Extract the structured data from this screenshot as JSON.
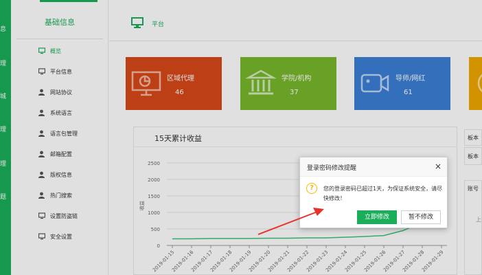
{
  "strip_chars": [
    "息",
    "理",
    "城",
    "理",
    "理",
    "题"
  ],
  "sidebar": {
    "title": "基础信息",
    "items": [
      {
        "label": "概览",
        "icon": "monitor-icon"
      },
      {
        "label": "平台信息",
        "icon": "monitor-icon"
      },
      {
        "label": "网站协议",
        "icon": "user-icon"
      },
      {
        "label": "系统语言",
        "icon": "user-icon"
      },
      {
        "label": "语言包管理",
        "icon": "user-icon"
      },
      {
        "label": "邮箱配置",
        "icon": "user-icon"
      },
      {
        "label": "版权信息",
        "icon": "user-icon"
      },
      {
        "label": "热门搜索",
        "icon": "user-icon"
      },
      {
        "label": "设置防盗链",
        "icon": "monitor-icon"
      },
      {
        "label": "安全设置",
        "icon": "monitor-icon"
      }
    ]
  },
  "header": {
    "title": "平台",
    "icon": "monitor-icon"
  },
  "cards": [
    {
      "label": "区域代理",
      "value": "46",
      "color": "#d6481a",
      "icon": "presentation-chart-icon"
    },
    {
      "label": "学院/机构",
      "value": "37",
      "color": "#77b82c",
      "icon": "institution-icon"
    },
    {
      "label": "导师/网红",
      "value": "61",
      "color": "#3c7fd6",
      "icon": "video-camera-icon"
    },
    {
      "label": "",
      "value": "",
      "color": "#f0a800",
      "icon": "target-icon"
    }
  ],
  "right_panels": [
    "板本",
    "板本",
    "账号",
    "上"
  ],
  "chart_data": {
    "type": "line",
    "title": "15天累计收益",
    "ylabel": "收益",
    "xlabel": "",
    "ylim": [
      0,
      2500
    ],
    "yticks": [
      "0",
      "500",
      "1000",
      "1500",
      "2000",
      "2500"
    ],
    "categories": [
      "2019-01-15",
      "2019-01-16",
      "2019-01-17",
      "2019-01-18",
      "2019-01-19",
      "2019-01-20",
      "2019-01-21",
      "2019-01-22",
      "2019-01-23",
      "2019-01-24",
      "2019-01-25",
      "2019-01-26",
      "2019-01-27",
      "2019-01-28",
      "2019-01-29"
    ],
    "values": [
      200,
      200,
      210,
      210,
      210,
      220,
      220,
      230,
      230,
      250,
      270,
      300,
      450,
      700,
      950
    ],
    "line_color": "#3cc27a",
    "grid": true
  },
  "dialog": {
    "title": "登录密码修改提醒",
    "close_symbol": "×",
    "warn_symbol": "?",
    "message": "您的登录密码已超过1天，为保证系统安全，请尽快修改！",
    "primary_label": "立即修改",
    "secondary_label": "暂不修改"
  }
}
